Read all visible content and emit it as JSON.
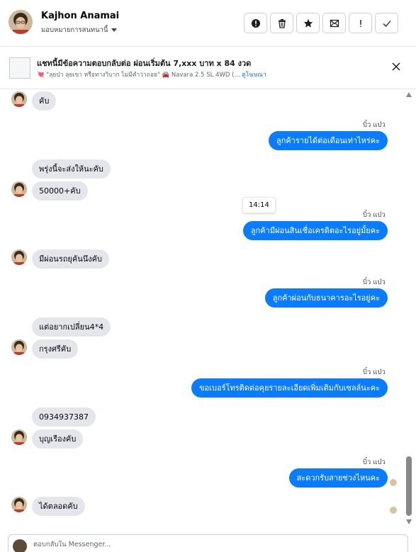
{
  "header": {
    "contact_name": "Kajhon Anamai",
    "assign_label": "มอบหมายการสนทนานี้",
    "actions": [
      {
        "icon": "alert-circle-icon"
      },
      {
        "icon": "trash-icon"
      },
      {
        "icon": "star-icon"
      },
      {
        "icon": "mark-unread-icon"
      },
      {
        "icon": "exclamation-icon"
      },
      {
        "icon": "check-icon"
      }
    ]
  },
  "banner": {
    "title": "แชทนี้มีข้อความตอบกลับต่อ ผ่อนเริ่มต้น 7,xxx บาท x 84 งวด",
    "subtitle": "💘 \"ลุยป่า ลุยเขา หรือทางวิบาก ไม่มีคำว่าถอย\" 🚘 Navara 2.5 SL 4WD (...",
    "link": "ดูโฆษณา"
  },
  "chat": {
    "timestamp": "14:14",
    "messages": [
      {
        "dir": "in",
        "text": "คับ"
      },
      {
        "dir": "out",
        "sender": "บิ๋ว แบ๋ว",
        "text": "ลูกค้ารายได้ต่อเดือนเท่าไหร่คะ"
      },
      {
        "dir": "in",
        "text": "พรุ่งนี้จะส่งให้นะคับ"
      },
      {
        "dir": "in",
        "text": "50000+คับ"
      },
      {
        "dir": "out",
        "sender": "บิ๋ว แบ๋ว",
        "text": "ลูกค้ามีผ่อนสินเชื่อเครดิตอะไรอยู่มั้ยคะ"
      },
      {
        "dir": "in",
        "text": "มีผ่อนรถยุคันนึงคับ"
      },
      {
        "dir": "out",
        "sender": "บิ๋ว แบ๋ว",
        "text": "ลูกค้าผ่อนกับธนาคารอะไรอยู่คะ"
      },
      {
        "dir": "in",
        "text": "แต่อยากเปลี่ยน4*4"
      },
      {
        "dir": "in",
        "text": "กรุงศรีคับ"
      },
      {
        "dir": "out",
        "sender": "บิ๋ว แบ๋ว",
        "text": "ขอเบอร์โทรติดต่อคุยรายละเอียดเพิ่มเติมกับเซลล์นะคะ"
      },
      {
        "dir": "in",
        "text": "0934937387"
      },
      {
        "dir": "in",
        "text": "บุญเรืองคับ"
      },
      {
        "dir": "out",
        "sender": "บิ๋ว แบ๋ว",
        "text": "สะดวกรับสายช่วงไหนคะ"
      },
      {
        "dir": "in",
        "text": "ได้ตลอดคับ"
      }
    ]
  },
  "composer": {
    "placeholder": "ตอบกลับใน Messenger..."
  },
  "colors": {
    "outgoing_bubble": "#0a7cff",
    "incoming_bubble": "#e4e6eb",
    "link": "#1877f2"
  }
}
